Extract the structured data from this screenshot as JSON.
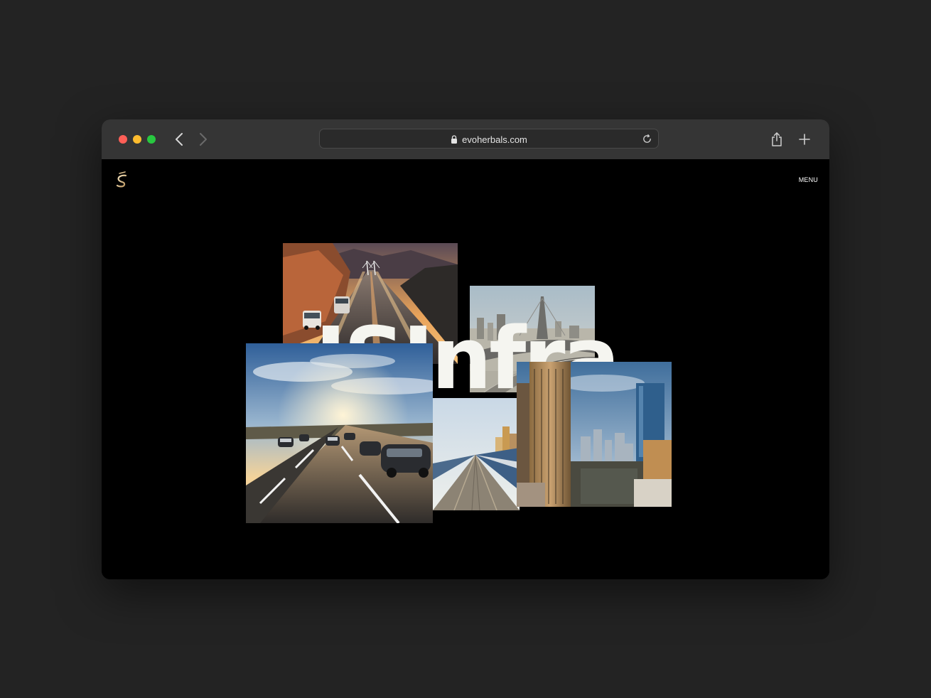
{
  "browser": {
    "url": "evoherbals.com",
    "back_icon": "chevron-left-icon",
    "forward_icon": "chevron-right-icon",
    "lock_icon": "lock-icon",
    "reload_icon": "reload-icon",
    "share_icon": "share-icon",
    "new_tab_icon": "plus-icon"
  },
  "site": {
    "logo_icon": "brand-logo-icon",
    "menu_label": "MENU",
    "hero_title": "JSInfra"
  },
  "photos": [
    {
      "name": "highway-bridge-sunset-photo"
    },
    {
      "name": "sea-link-bridge-city-photo"
    },
    {
      "name": "highway-traffic-sunset-photo"
    },
    {
      "name": "train-platform-photo"
    },
    {
      "name": "city-skyscrapers-photo"
    }
  ],
  "colors": {
    "page_bg": "#000000",
    "toolbar_bg": "#353535",
    "hero_text": "#f5f5f0"
  }
}
